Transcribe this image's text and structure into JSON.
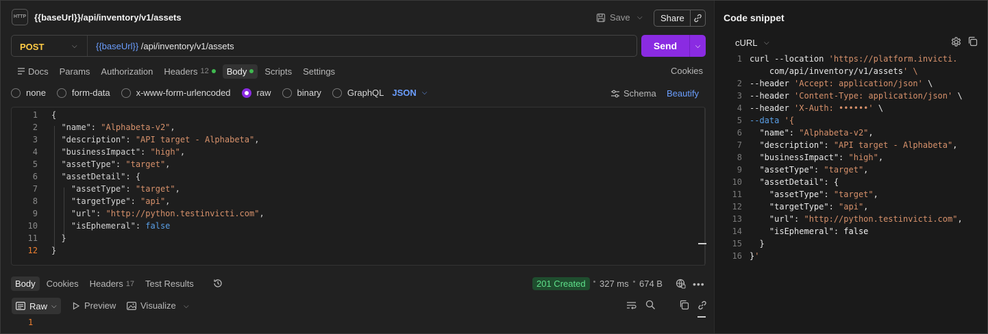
{
  "request": {
    "icon_label": "HTTP",
    "title": "{{baseUrl}}/api/inventory/v1/assets",
    "save_label": "Save",
    "share_label": "Share",
    "method": "POST",
    "url_var": "{{baseUrl}}",
    "url_path": " /api/inventory/v1/assets",
    "send_label": "Send"
  },
  "tabs": [
    {
      "label": "Docs"
    },
    {
      "label": "Params"
    },
    {
      "label": "Authorization"
    },
    {
      "label": "Headers",
      "count": "12"
    },
    {
      "label": "Body"
    },
    {
      "label": "Scripts"
    },
    {
      "label": "Settings"
    }
  ],
  "cookies_label": "Cookies",
  "body_types": [
    {
      "label": "none",
      "selected": false
    },
    {
      "label": "form-data",
      "selected": false
    },
    {
      "label": "x-www-form-urlencoded",
      "selected": false
    },
    {
      "label": "raw",
      "selected": true
    },
    {
      "label": "binary",
      "selected": false
    },
    {
      "label": "GraphQL",
      "selected": false
    }
  ],
  "body_format": "JSON",
  "schema_label": "Schema",
  "beautify_label": "Beautify",
  "editor": {
    "lines": [
      {
        "n": "1",
        "t": "{"
      },
      {
        "n": "2",
        "t": "  \"name\": \"Alphabeta-v2\","
      },
      {
        "n": "3",
        "t": "  \"description\": \"API target - Alphabeta\","
      },
      {
        "n": "4",
        "t": "  \"businessImpact\": \"high\","
      },
      {
        "n": "5",
        "t": "  \"assetType\": \"target\","
      },
      {
        "n": "6",
        "t": "  \"assetDetail\": {"
      },
      {
        "n": "7",
        "t": "    \"assetType\": \"target\","
      },
      {
        "n": "8",
        "t": "    \"targetType\": \"api\","
      },
      {
        "n": "9",
        "t": "    \"url\": \"http://python.testinvicti.com\","
      },
      {
        "n": "10",
        "t": "    \"isEphemeral\": false"
      },
      {
        "n": "11",
        "t": "  }"
      },
      {
        "n": "12",
        "t": "}"
      }
    ]
  },
  "response": {
    "tabs": [
      {
        "label": "Body"
      },
      {
        "label": "Cookies"
      },
      {
        "label": "Headers",
        "count": "17"
      },
      {
        "label": "Test Results"
      }
    ],
    "status": "201 Created",
    "time": "327 ms",
    "size": "674 B",
    "raw_label": "Raw",
    "preview_label": "Preview",
    "visualize_label": "Visualize",
    "first_line": "1"
  },
  "snippet": {
    "title": "Code snippet",
    "language": "cURL",
    "lines": [
      {
        "n": "1",
        "t": "curl --location 'https://platform.invicti."
      },
      {
        "n": "",
        "t": "    com/api/inventory/v1/assets' \\"
      },
      {
        "n": "2",
        "t": "--header 'Accept: application/json' \\"
      },
      {
        "n": "3",
        "t": "--header 'Content-Type: application/json' \\"
      },
      {
        "n": "4",
        "t": "--header 'X-Auth: ••••••' \\"
      },
      {
        "n": "5",
        "t": "--data '{"
      },
      {
        "n": "6",
        "t": "  \"name\": \"Alphabeta-v2\","
      },
      {
        "n": "7",
        "t": "  \"description\": \"API target - Alphabeta\","
      },
      {
        "n": "8",
        "t": "  \"businessImpact\": \"high\","
      },
      {
        "n": "9",
        "t": "  \"assetType\": \"target\","
      },
      {
        "n": "10",
        "t": "  \"assetDetail\": {"
      },
      {
        "n": "11",
        "t": "    \"assetType\": \"target\","
      },
      {
        "n": "12",
        "t": "    \"targetType\": \"api\","
      },
      {
        "n": "13",
        "t": "    \"url\": \"http://python.testinvicti.com\","
      },
      {
        "n": "14",
        "t": "    \"isEphemeral\": false"
      },
      {
        "n": "15",
        "t": "  }"
      },
      {
        "n": "16",
        "t": "}'"
      }
    ]
  },
  "colors": {
    "send": "#8a2be2",
    "method": "#ffcb45",
    "variable": "#6b9eff",
    "string": "#d7916b",
    "status_ok": "#5ee08a"
  }
}
